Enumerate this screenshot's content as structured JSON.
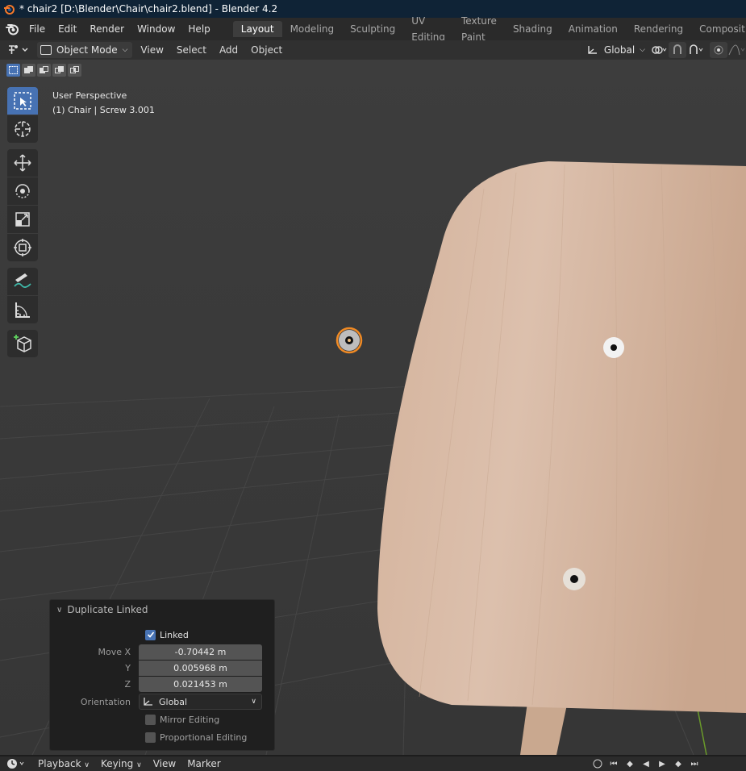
{
  "window": {
    "title": "* chair2 [D:\\Blender\\Chair\\chair2.blend] - Blender 4.2"
  },
  "menu": {
    "items": [
      "File",
      "Edit",
      "Render",
      "Window",
      "Help"
    ]
  },
  "workspaces": {
    "active": "Layout",
    "tabs": [
      "Layout",
      "Modeling",
      "Sculpting",
      "UV Editing",
      "Texture Paint",
      "Shading",
      "Animation",
      "Rendering",
      "Compositing"
    ]
  },
  "viewport_header": {
    "mode": "Object Mode",
    "menus": [
      "View",
      "Select",
      "Add",
      "Object"
    ],
    "orientation": "Global"
  },
  "viewport": {
    "perspective": "User Perspective",
    "object_info": "(1) Chair | Screw 3.001"
  },
  "operator_panel": {
    "title": "Duplicate Linked",
    "linked_label": "Linked",
    "linked_checked": true,
    "move_x_label": "Move X",
    "move_x": "-0.70442 m",
    "y_label": "Y",
    "y": "0.005968 m",
    "z_label": "Z",
    "z": "0.021453 m",
    "orientation_label": "Orientation",
    "orientation_value": "Global",
    "mirror_label": "Mirror Editing",
    "mirror_checked": false,
    "proportional_label": "Proportional Editing",
    "proportional_checked": false
  },
  "timeline": {
    "menus": [
      "Playback",
      "Keying",
      "View",
      "Marker"
    ]
  },
  "colors": {
    "accent": "#4772b3",
    "selection": "#f08a24",
    "wood": "#d9bba6",
    "title_bar": "#0f2336"
  }
}
